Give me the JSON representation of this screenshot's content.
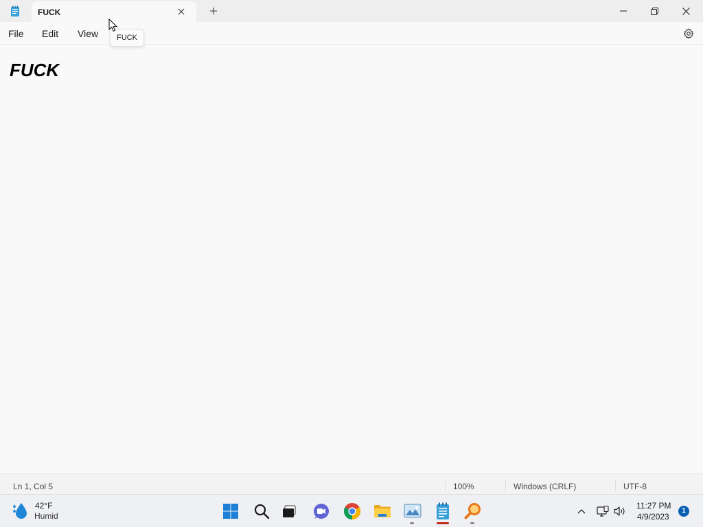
{
  "window": {
    "tab_title": "FUCK",
    "tooltip": "FUCK",
    "icons": {
      "app": "notepad-icon",
      "tab_close": "close-icon",
      "new_tab": "plus-icon",
      "minimize": "minimize-icon",
      "maximize": "restore-icon",
      "close": "close-icon"
    }
  },
  "menu": {
    "items": [
      {
        "label": "File"
      },
      {
        "label": "Edit"
      },
      {
        "label": "View"
      }
    ],
    "settings_icon": "gear-icon"
  },
  "editor": {
    "content": "FUCK"
  },
  "status": {
    "position": "Ln 1, Col 5",
    "zoom": "100%",
    "line_ending": "Windows (CRLF)",
    "encoding": "UTF-8"
  },
  "taskbar": {
    "weather": {
      "temp": "42°F",
      "condition": "Humid",
      "icon": "humidity-drop-icon"
    },
    "apps": [
      {
        "name": "start",
        "icon": "windows-start-icon"
      },
      {
        "name": "search",
        "icon": "search-icon"
      },
      {
        "name": "task-view",
        "icon": "task-view-icon"
      },
      {
        "name": "teams-chat",
        "icon": "chat-video-icon"
      },
      {
        "name": "chrome",
        "icon": "chrome-icon"
      },
      {
        "name": "file-explorer",
        "icon": "folder-icon"
      },
      {
        "name": "photo-viewer",
        "icon": "photo-icon"
      },
      {
        "name": "notepad",
        "icon": "notepad-icon",
        "active": true
      },
      {
        "name": "search-tool",
        "icon": "magnifier-orange-icon"
      }
    ],
    "tray": {
      "chevron": "chevron-up-icon",
      "network": "network-icon",
      "volume": "volume-icon"
    },
    "clock": {
      "time": "11:27 PM",
      "date": "4/9/2023"
    },
    "notifications": "1"
  },
  "colors": {
    "accent": "#0a5fb4",
    "active_indicator": "#c42b1c"
  }
}
